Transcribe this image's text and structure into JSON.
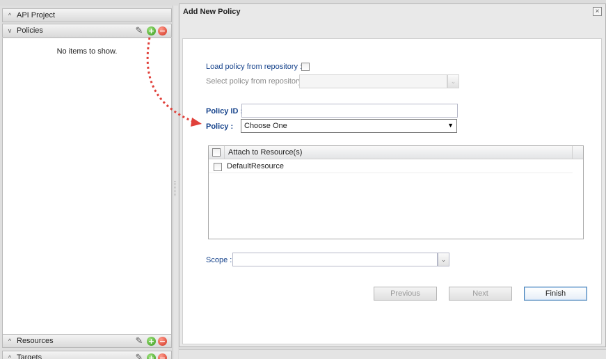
{
  "left_panel": {
    "sections": [
      {
        "title": "API Project",
        "chevron": "^",
        "tools": false
      },
      {
        "title": "Policies",
        "chevron": "v",
        "tools": true
      },
      {
        "title": "Resources",
        "chevron": "^",
        "tools": true
      },
      {
        "title": "Targets",
        "chevron": "^",
        "tools": true
      }
    ],
    "empty_text": "No items to show."
  },
  "icons": {
    "edit": "pencil-icon",
    "add": "add-icon",
    "remove": "remove-icon",
    "close": "close-icon",
    "dropdown": "chevron-down-icon",
    "collapse": "chevron-up-icon"
  },
  "glyphs": {
    "edit": "✎",
    "add": "+",
    "remove": "−",
    "close": "×",
    "dropdown": "▼",
    "trigger": "⌄",
    "chev_up": "^",
    "chev_down": "v"
  },
  "dialog": {
    "title": "Add New Policy",
    "load_repo_label": "Load policy from repository :",
    "select_repo_label": "Select policy from repository :",
    "select_repo_value": "",
    "policy_id_label": "Policy ID :",
    "policy_id_value": "",
    "policy_label": "Policy :",
    "policy_selected": "Choose One",
    "grid": {
      "header": "Attach to Resource(s)",
      "rows": [
        "DefaultResource"
      ]
    },
    "scope_label": "Scope :",
    "scope_value": "",
    "buttons": {
      "previous": "Previous",
      "next": "Next",
      "finish": "Finish"
    }
  },
  "colors": {
    "label_blue": "#15428b",
    "annotation_arrow": "#e0403a",
    "finish_border": "#3d7bb4"
  }
}
